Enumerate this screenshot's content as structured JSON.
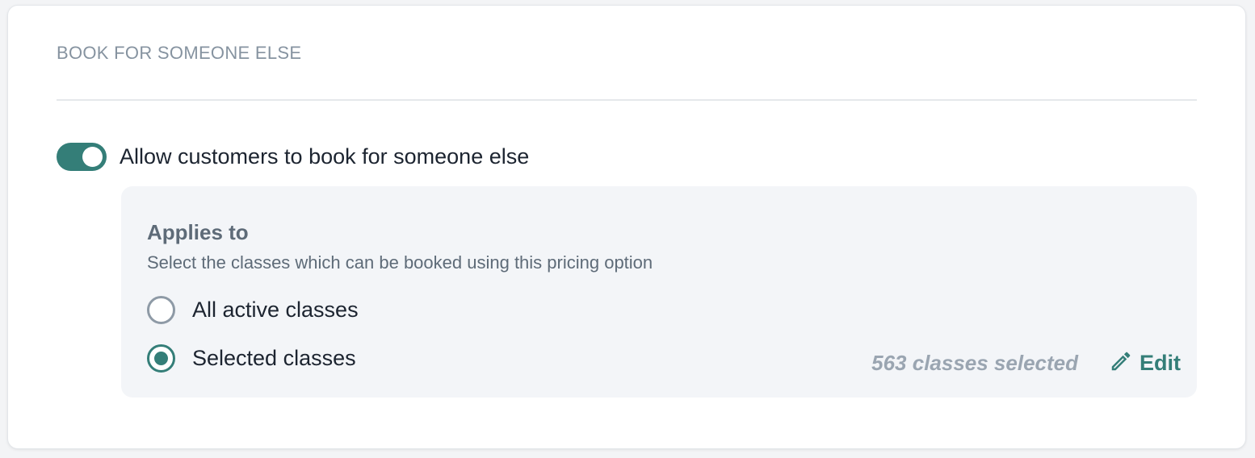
{
  "section": {
    "title": "BOOK FOR SOMEONE ELSE"
  },
  "toggle": {
    "label": "Allow customers to book for someone else",
    "checked": true
  },
  "applies_to": {
    "title": "Applies to",
    "subtitle": "Select the classes which can be booked using this pricing option",
    "options": [
      {
        "label": "All active classes",
        "checked": false
      },
      {
        "label": "Selected classes",
        "checked": true
      }
    ],
    "selected_count_text": "563 classes selected",
    "edit_label": "Edit"
  },
  "colors": {
    "accent": "#347e78",
    "muted_text": "#8693a0",
    "panel_bg": "#f3f5f8"
  },
  "icons": {
    "edit": "pencil-icon"
  }
}
